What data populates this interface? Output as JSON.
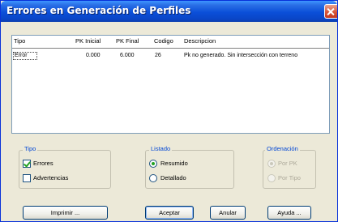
{
  "window": {
    "title": "Errores en Generación de Perfiles"
  },
  "list": {
    "columns": [
      "Tipo",
      "PK Inicial",
      "PK Final",
      "Codigo",
      "Descripcion"
    ],
    "rows": [
      {
        "tipo": "Error",
        "pk_inicial": "0.000",
        "pk_final": "6.000",
        "codigo": "26",
        "descripcion": "Pk no generado. Sin intersección con terreno"
      }
    ]
  },
  "groups": {
    "tipo": {
      "label": "Tipo",
      "errores": "Errores",
      "advertencias": "Advertencias",
      "errores_checked": true,
      "advertencias_checked": false
    },
    "listado": {
      "label": "Listado",
      "resumido": "Resumido",
      "detallado": "Detallado",
      "selected": "Resumido"
    },
    "ordenacion": {
      "label": "Ordenación",
      "por_pk": "Por PK",
      "por_tipo": "Por Tipo",
      "selected": "Por PK",
      "enabled": false
    }
  },
  "buttons": {
    "imprimir": "Imprimir ...",
    "aceptar": "Aceptar",
    "anular": "Anular",
    "ayuda": "Ayuda ..."
  }
}
